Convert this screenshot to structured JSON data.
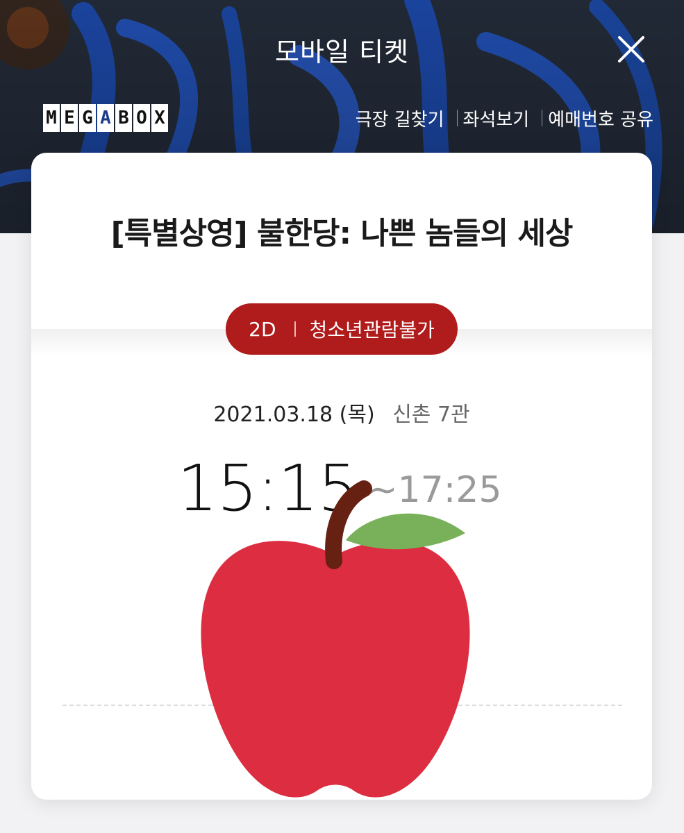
{
  "header": {
    "title": "모바일 티켓",
    "close_icon": "close-icon"
  },
  "brand": {
    "letters": [
      "M",
      "E",
      "G",
      "A",
      "B",
      "O",
      "X"
    ]
  },
  "top_links": [
    {
      "label": "극장 길찾기"
    },
    {
      "label": "좌석보기"
    },
    {
      "label": "예매번호 공유"
    }
  ],
  "ticket": {
    "movie_title": "[특별상영] 불한당: 나쁜 놈들의 세상",
    "format": "2D",
    "rating": "청소년관람불가",
    "date": "2021.03.18 (목)",
    "theater": "신촌 7관",
    "start_time": "15:15",
    "end_time": "~17:25"
  },
  "overlay": {
    "icon": "apple-icon"
  },
  "colors": {
    "pill": "#b01b1b",
    "apple": "#dc2d41",
    "leaf": "#78b159",
    "stem": "#662113"
  }
}
